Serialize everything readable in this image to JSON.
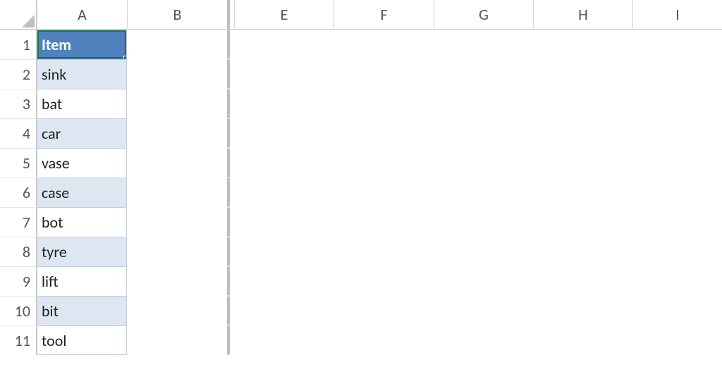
{
  "columns": [
    "A",
    "B",
    "E",
    "F",
    "G",
    "H",
    "I"
  ],
  "row_numbers": [
    1,
    2,
    3,
    4,
    5,
    6,
    7,
    8,
    9,
    10,
    11
  ],
  "table": {
    "header": "Item",
    "rows": [
      "sink",
      "bat",
      "car",
      "vase",
      "case",
      "bot",
      "tyre",
      "lift",
      "bit",
      "tool"
    ]
  },
  "selection": {
    "cell": "A1"
  },
  "colors": {
    "header_fill": "#4f81bd",
    "band_fill": "#dde6f1",
    "selection": "#1f7246"
  },
  "chart_data": {
    "type": "table",
    "columns": [
      "Item"
    ],
    "rows": [
      [
        "sink"
      ],
      [
        "bat"
      ],
      [
        "car"
      ],
      [
        "vase"
      ],
      [
        "case"
      ],
      [
        "bot"
      ],
      [
        "tyre"
      ],
      [
        "lift"
      ],
      [
        "bit"
      ],
      [
        "tool"
      ]
    ]
  }
}
